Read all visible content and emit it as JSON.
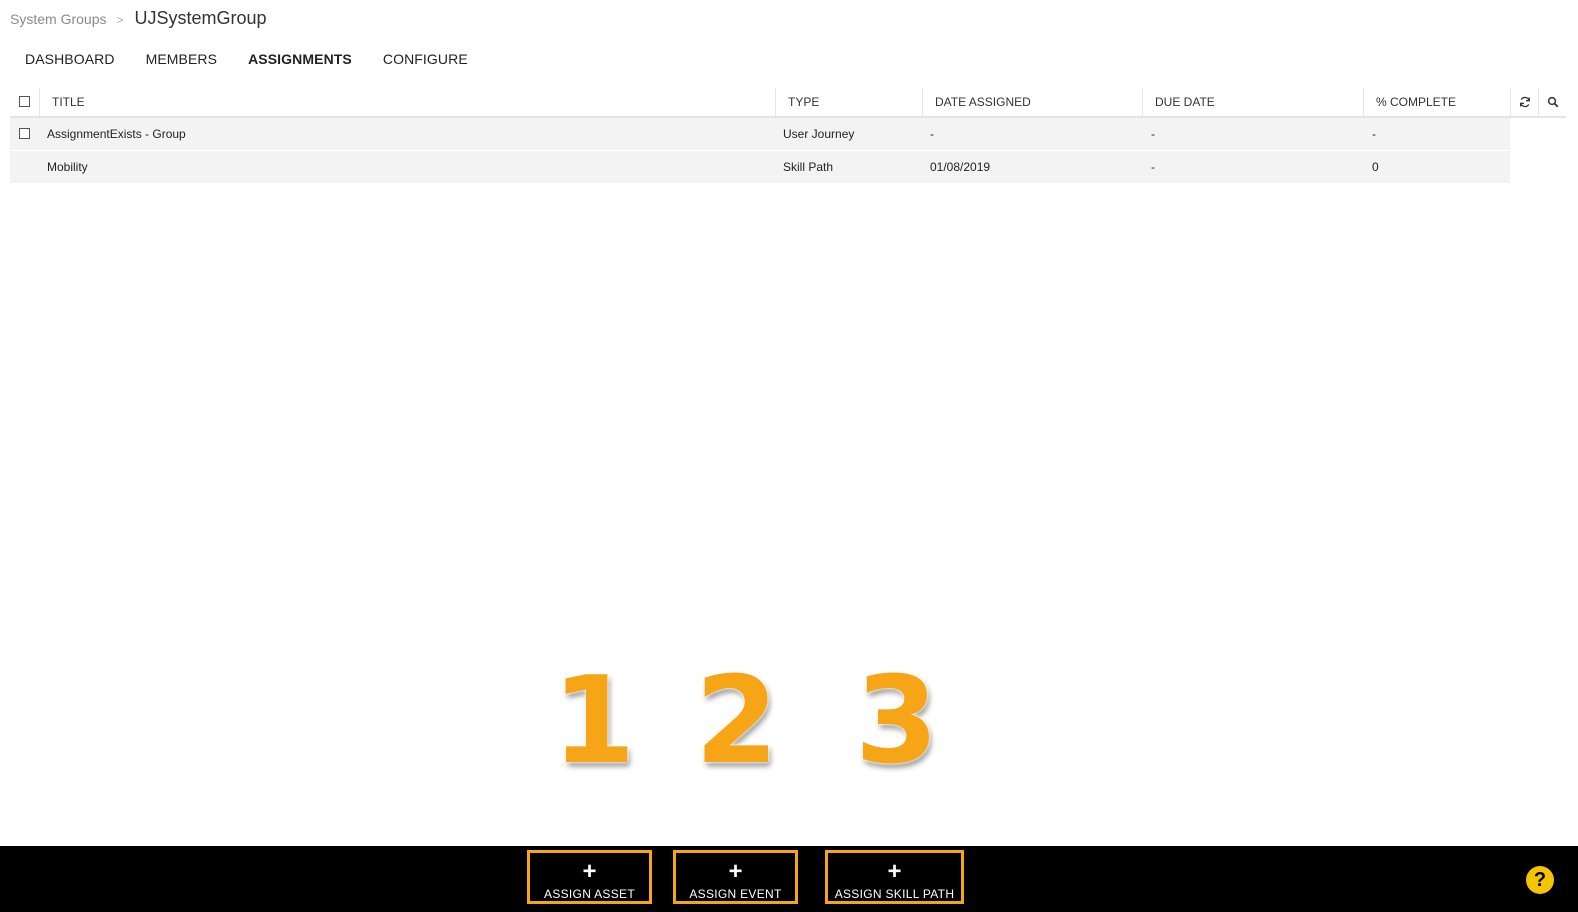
{
  "breadcrumb": {
    "parent": "System Groups",
    "separator": ">",
    "current": "UJSystemGroup"
  },
  "tabs": [
    {
      "label": "DASHBOARD",
      "active": false
    },
    {
      "label": "MEMBERS",
      "active": false
    },
    {
      "label": "ASSIGNMENTS",
      "active": true
    },
    {
      "label": "CONFIGURE",
      "active": false
    }
  ],
  "grid": {
    "columns": [
      "TITLE",
      "TYPE",
      "DATE ASSIGNED",
      "DUE DATE",
      "% COMPLETE"
    ],
    "header_icons": [
      "refresh-icon",
      "search-icon"
    ],
    "rows": [
      {
        "title": "AssignmentExists - Group",
        "type": "User Journey",
        "date_assigned": "-",
        "due_date": "-",
        "complete": "-",
        "has_checkbox": true
      },
      {
        "title": "Mobility",
        "type": "Skill Path",
        "date_assigned": "01/08/2019",
        "due_date": "-",
        "complete": "0",
        "has_checkbox": false
      }
    ]
  },
  "callouts": [
    "1",
    "2",
    "3"
  ],
  "footer": {
    "buttons": [
      {
        "icon": "+",
        "label": "ASSIGN ASSET"
      },
      {
        "icon": "+",
        "label": "ASSIGN EVENT"
      },
      {
        "icon": "+",
        "label": "ASSIGN SKILL PATH"
      }
    ],
    "help_icon": "?"
  },
  "colors": {
    "accent": "#f5a516",
    "footer_bg": "#000000",
    "row_bg": "#f3f3f3",
    "help": "#f5c400"
  }
}
